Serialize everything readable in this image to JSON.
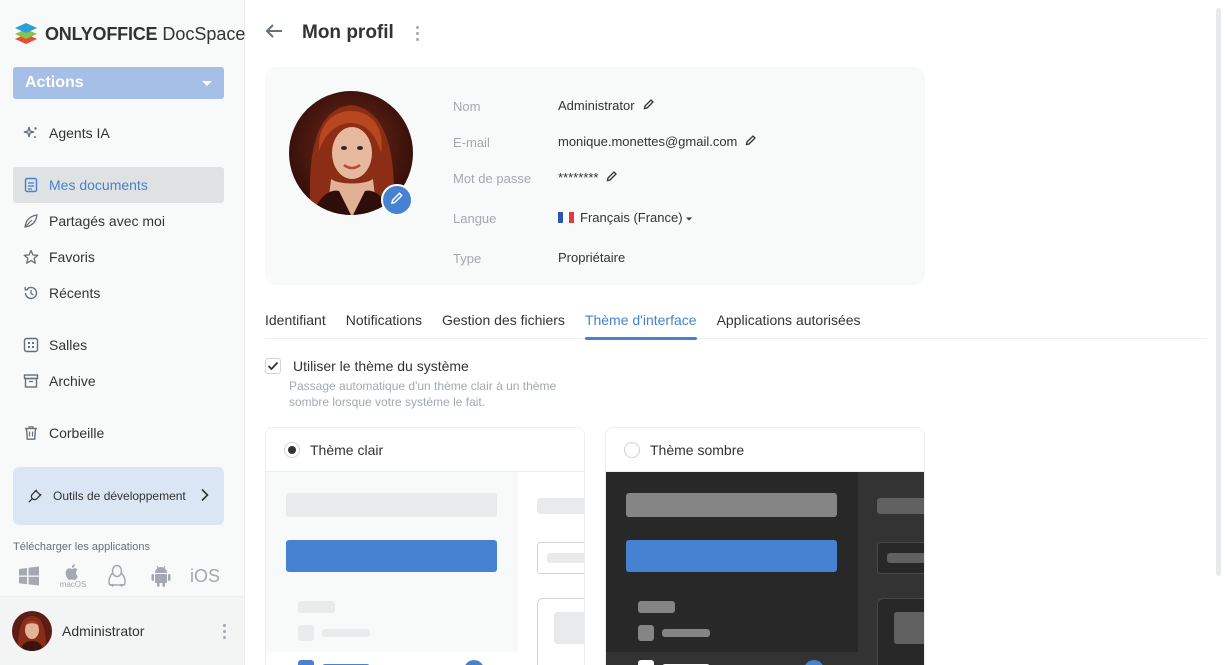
{
  "app": {
    "logo_bold": "ONLYOFFICE",
    "logo_light": " DocSpace"
  },
  "sidebar": {
    "actions_label": "Actions",
    "items": [
      {
        "label": "Agents IA",
        "icon": "sparkle-icon"
      },
      {
        "label": "Mes documents",
        "icon": "document-icon",
        "active": true
      },
      {
        "label": "Partagés avec moi",
        "icon": "share-icon"
      },
      {
        "label": "Favoris",
        "icon": "star-icon"
      },
      {
        "label": "Récents",
        "icon": "history-icon"
      },
      {
        "label": "Salles",
        "icon": "rooms-icon"
      },
      {
        "label": "Archive",
        "icon": "archive-icon"
      },
      {
        "label": "Corbeille",
        "icon": "trash-icon"
      }
    ],
    "dev_tools_label": "Outils de développement",
    "download_label": "Télécharger les applications",
    "download_apps": [
      "windows",
      "macOS",
      "linux",
      "android",
      "iOS"
    ],
    "macos_label": "macOS",
    "ios_label": "iOS",
    "user_name": "Administrator"
  },
  "header": {
    "title": "Mon profil"
  },
  "profile": {
    "fields": [
      {
        "label": "Nom",
        "value": "Administrator"
      },
      {
        "label": "E-mail",
        "value": "monique.monettes@gmail.com"
      },
      {
        "label": "Mot de passe",
        "value": "********"
      },
      {
        "label": "Langue",
        "value": "Français (France)"
      },
      {
        "label": "Type",
        "value": "Propriétaire"
      }
    ]
  },
  "tabs": [
    {
      "label": "Identifiant"
    },
    {
      "label": "Notifications"
    },
    {
      "label": "Gestion des fichiers"
    },
    {
      "label": "Thème d'interface",
      "active": true
    },
    {
      "label": "Applications autorisées"
    }
  ],
  "theme": {
    "use_system_label": "Utiliser le thème du système",
    "use_system_checked": true,
    "description": "Passage automatique d'un thème clair à un thème sombre lorsque votre système le fait.",
    "light_label": "Thème clair",
    "dark_label": "Thème sombre",
    "selected": "light"
  },
  "colors": {
    "accent": "#4781d1",
    "actions_bg": "#a5bfe6",
    "dark_preview": "#333333"
  }
}
